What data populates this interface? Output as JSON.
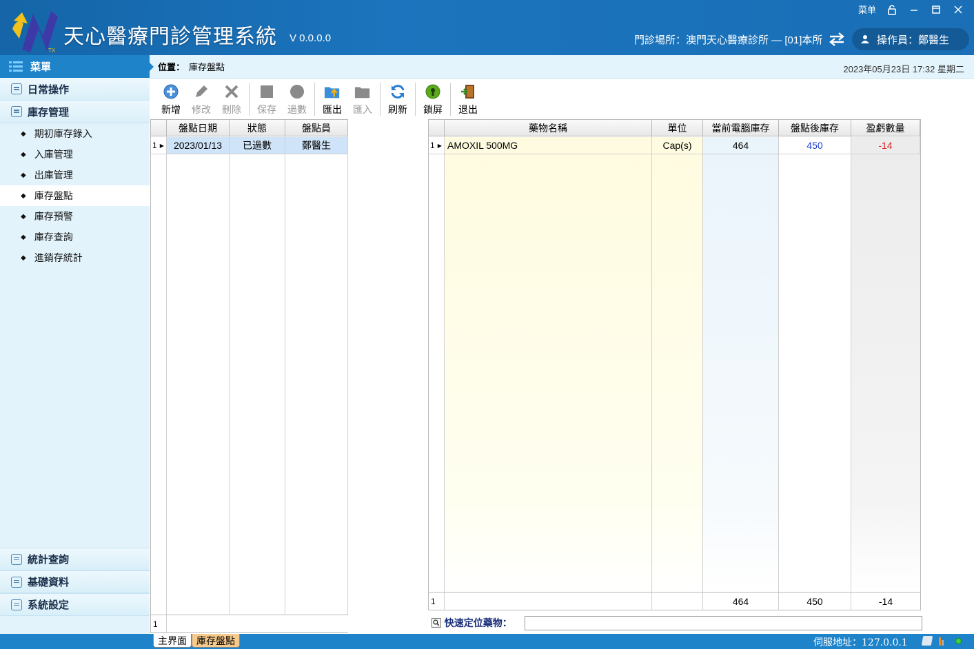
{
  "header": {
    "title": "天心醫療門診管理系統",
    "version": "V 0.0.0.0",
    "menu_label": "菜单",
    "clinic": "門診場所：澳門天心醫療診所 — [01]本所",
    "operator": "操作員：鄭醫生"
  },
  "sidebar": {
    "header": "菜單",
    "groups_top": [
      {
        "label": "日常操作"
      },
      {
        "label": "庫存管理"
      }
    ],
    "sub_items": [
      {
        "label": "期初庫存錄入"
      },
      {
        "label": "入庫管理"
      },
      {
        "label": "出庫管理"
      },
      {
        "label": "庫存盤點"
      },
      {
        "label": "庫存預警"
      },
      {
        "label": "庫存查詢"
      },
      {
        "label": "進銷存統計"
      }
    ],
    "groups_bottom": [
      {
        "label": "統計查詢"
      },
      {
        "label": "基礎資料"
      },
      {
        "label": "系統設定"
      }
    ]
  },
  "breadcrumb": {
    "label": "位置：",
    "value": "庫存盤點",
    "datetime": "2023年05月23日 17:32  星期二"
  },
  "toolbar": {
    "add": "新增",
    "edit": "修改",
    "delete": "刪除",
    "save": "保存",
    "post": "過數",
    "export": "匯出",
    "import": "匯入",
    "refresh": "刷新",
    "lock": "鎖屏",
    "exit": "退出"
  },
  "left_table": {
    "headers": [
      "盤點日期",
      "狀態",
      "盤點員"
    ],
    "rows": [
      {
        "no": "1",
        "date": "2023/01/13",
        "status": "已過數",
        "staff": "鄭醫生"
      }
    ],
    "footer_no": "1"
  },
  "right_table": {
    "headers": [
      "藥物名稱",
      "單位",
      "當前電腦庫存",
      "盤點後庫存",
      "盈虧數量"
    ],
    "rows": [
      {
        "no": "1",
        "name": "AMOXIL 500MG",
        "unit": "Cap(s)",
        "current": "464",
        "after": "450",
        "diff": "-14"
      }
    ],
    "footer": {
      "no": "1",
      "current": "464",
      "after": "450",
      "diff": "-14"
    }
  },
  "quick_search": {
    "label": "快速定位藥物：",
    "value": ""
  },
  "status_bar": {
    "tabs": [
      "主界面",
      "庫存盤點"
    ],
    "server": "伺服地址：127.0.0.1"
  },
  "colors": {
    "accent": "#1f83c9",
    "blue_value": "#1a3fd0",
    "red_value": "#e02020"
  }
}
